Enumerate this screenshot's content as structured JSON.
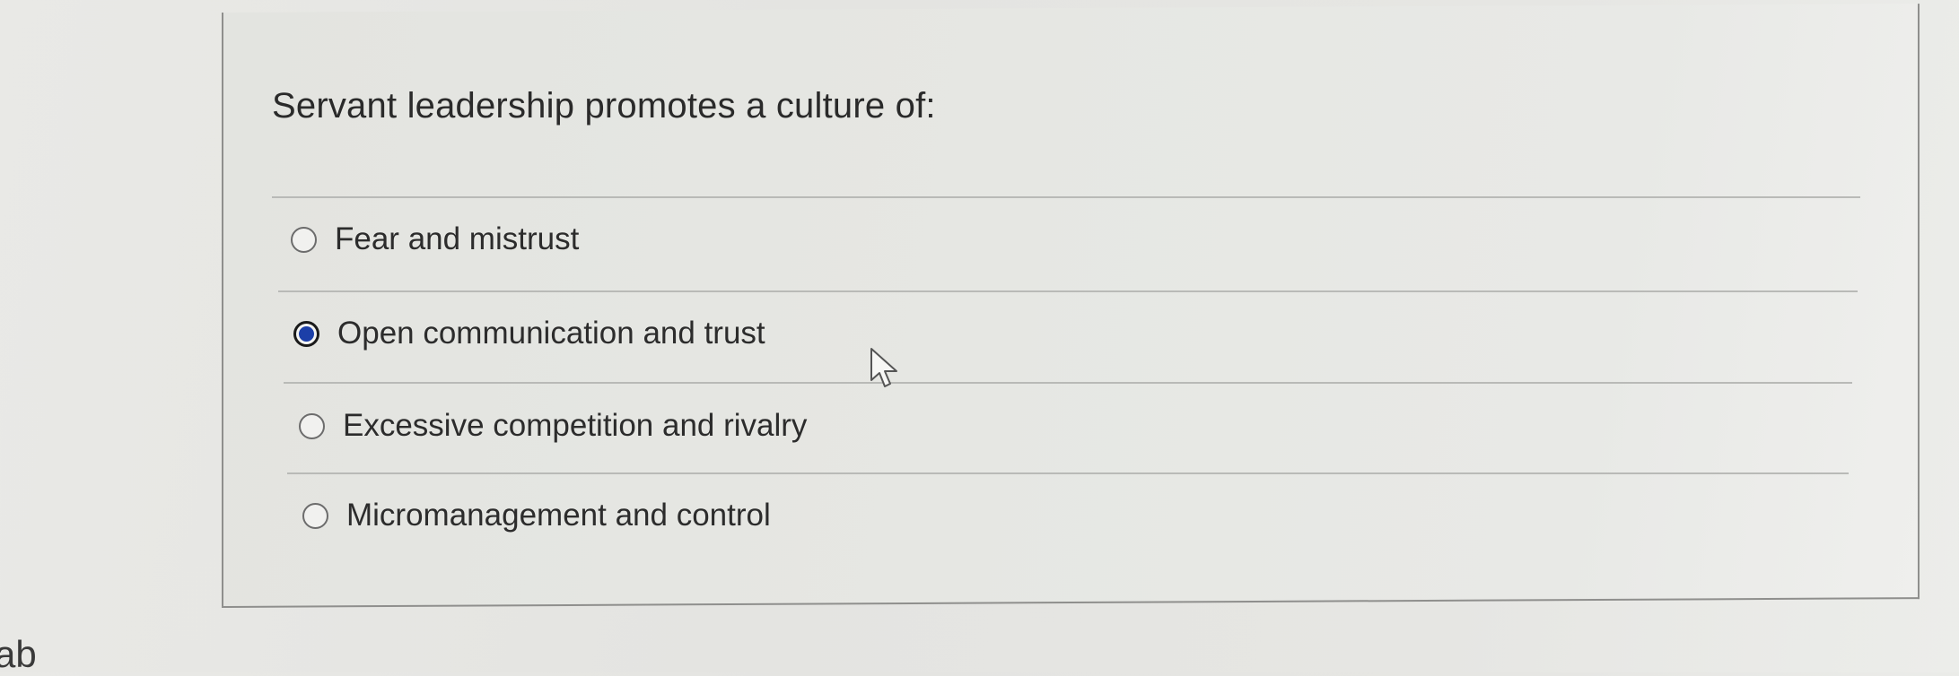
{
  "question": {
    "text": "Servant leadership promotes a culture of:"
  },
  "options": [
    {
      "label": "Fear and mistrust",
      "selected": false
    },
    {
      "label": "Open communication and trust",
      "selected": true
    },
    {
      "label": "Excessive competition and rivalry",
      "selected": false
    },
    {
      "label": "Micromanagement and control",
      "selected": false
    }
  ],
  "corner_text": "ab",
  "colors": {
    "selected_radio": "#1c3fa8",
    "divider": "#b9bab7",
    "card_border": "#8f8f8d"
  },
  "icons": {
    "cursor": "mouse-pointer-icon"
  }
}
